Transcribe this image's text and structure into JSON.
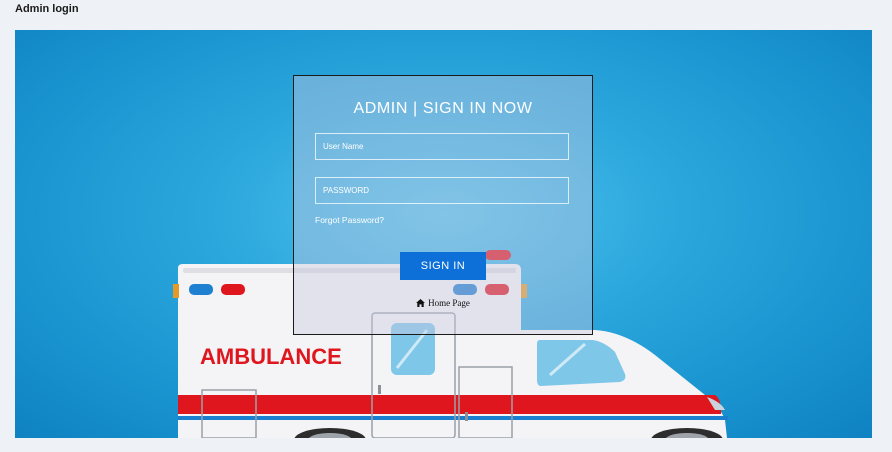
{
  "header": {
    "title": "Admin login"
  },
  "scene": {
    "vehicle_text": "AMBULANCE"
  },
  "login": {
    "title": "ADMIN | SIGN IN NOW",
    "username_placeholder": "User Name",
    "password_placeholder": "PASSWORD",
    "forgot_label": "Forgot Password?",
    "signin_label": "SIGN IN",
    "home_label": "Home Page"
  },
  "colors": {
    "accent": "#0d6fd8",
    "background_blue": "#1e9ad6",
    "ambulance_red": "#e0161e"
  }
}
